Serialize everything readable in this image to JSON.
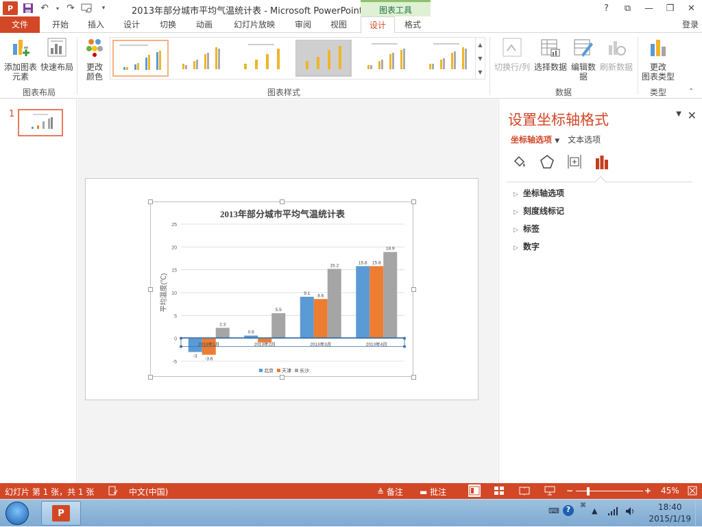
{
  "app": {
    "logo": "P",
    "window_title": "2013年部分城市平均气温统计表 - Microsoft PowerPoint",
    "context_tab_group": "图表工具",
    "login": "登录",
    "window_buttons": [
      "?",
      "⧉",
      "—",
      "❐",
      "✕"
    ]
  },
  "tabs": [
    "文件",
    "开始",
    "插入",
    "设计",
    "切换",
    "动画",
    "幻灯片放映",
    "审阅",
    "视图",
    "设计",
    "格式"
  ],
  "ribbon": {
    "add_element": [
      "添加图表",
      "元素"
    ],
    "quick_layout": "快速布局",
    "change_color": [
      "更改",
      "颜色"
    ],
    "switch_row_col": "切换行/列",
    "select_data": "选择数据",
    "edit_data": [
      "编辑数",
      "据"
    ],
    "refresh_data": "刷新数据",
    "change_type": [
      "更改",
      "图表类型"
    ],
    "group_layout": "图表布局",
    "group_styles": "图表样式",
    "group_data": "数据",
    "group_type": "类型"
  },
  "slides_pane": {
    "number": "1"
  },
  "chart_data": {
    "type": "bar",
    "title": "2013年部分城市平均气温统计表",
    "ylabel": "平均温度(℃)",
    "categories": [
      "2013年1月",
      "2013年2月",
      "2013年3月",
      "2013年4月"
    ],
    "series": [
      {
        "name": "北京",
        "values": [
          -3,
          0.6,
          9.1,
          15.8
        ],
        "color": "#5b9bd5"
      },
      {
        "name": "天津",
        "values": [
          -3.6,
          -0.9,
          8.6,
          15.8
        ],
        "color": "#ed7d31"
      },
      {
        "name": "长沙",
        "values": [
          2.3,
          5.5,
          15.2,
          18.9
        ],
        "color": "#a5a5a5"
      }
    ],
    "data_labels": [
      [
        "-3",
        "0.6",
        "9.1",
        "15.8"
      ],
      [
        "-3.6",
        "",
        "8.6",
        "15.8"
      ],
      [
        "2.3",
        "5.5",
        "15.2",
        "18.9"
      ]
    ],
    "ylim": [
      -5,
      25
    ],
    "yticks": [
      -5,
      0,
      5,
      10,
      15,
      20,
      25
    ],
    "grid": true,
    "legend": "bottom"
  },
  "format_pane": {
    "title": "设置坐标轴格式",
    "subtab_axis": "坐标轴选项",
    "subtab_text": "文本选项",
    "items": [
      "坐标轴选项",
      "刻度线标记",
      "标签",
      "数字"
    ]
  },
  "status": {
    "slide_info": "幻灯片 第 1 张，共 1 张",
    "language": "中文(中国)",
    "notes": "备注",
    "comments": "批注",
    "zoom": "45%",
    "minus": "−",
    "plus": "+"
  },
  "taskbar": {
    "time": "18:40",
    "date": "2015/1/19"
  }
}
